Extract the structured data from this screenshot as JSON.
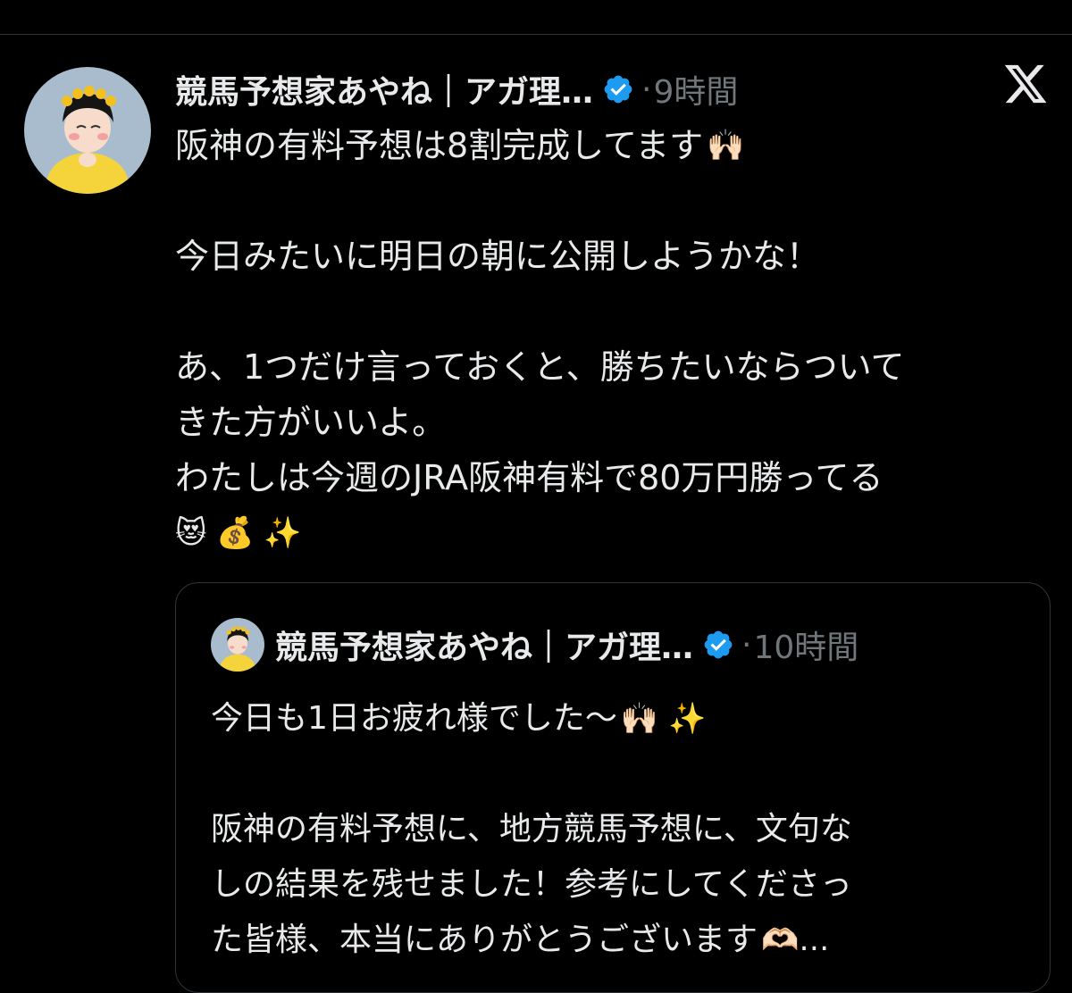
{
  "tweet": {
    "author_name": "競馬予想家あやね｜アガ理…",
    "dot": "·",
    "timestamp": "9時間",
    "lines": [
      {
        "text": "阪神の有料予想は8割完成してます",
        "emoji": "🙌🏻"
      },
      {
        "text": ""
      },
      {
        "text": "今日みたいに明日の朝に公開しようかな！"
      },
      {
        "text": ""
      },
      {
        "text": "あ、1つだけ言っておくと、勝ちたいならついて"
      },
      {
        "text": "きた方がいいよ。"
      },
      {
        "text": "わたしは今週のJRA阪神有料で80万円勝ってる"
      },
      {
        "text": "",
        "emoji": "😻 💰 ✨"
      }
    ]
  },
  "quoted_tweet": {
    "author_name": "競馬予想家あやね｜アガ理…",
    "dot": "·",
    "timestamp": "10時間",
    "lines": [
      {
        "text": "今日も1日お疲れ様でした〜",
        "emoji": "🙌🏻 ✨"
      },
      {
        "text": ""
      },
      {
        "text": "阪神の有料予想に、地方競馬予想に、文句な"
      },
      {
        "text": "しの結果を残せました！参考にしてくださっ"
      },
      {
        "text": "た皆様、本当にありがとうございます",
        "emoji": "🫶🏻…"
      }
    ]
  },
  "icons": {
    "verified": "verified-badge-icon",
    "platform_logo": "x-logo-icon"
  },
  "colors": {
    "background": "#000000",
    "text": "#e7e9ea",
    "secondary_text": "#71767b",
    "verified": "#1d9bf0",
    "divider": "#2f3336"
  }
}
